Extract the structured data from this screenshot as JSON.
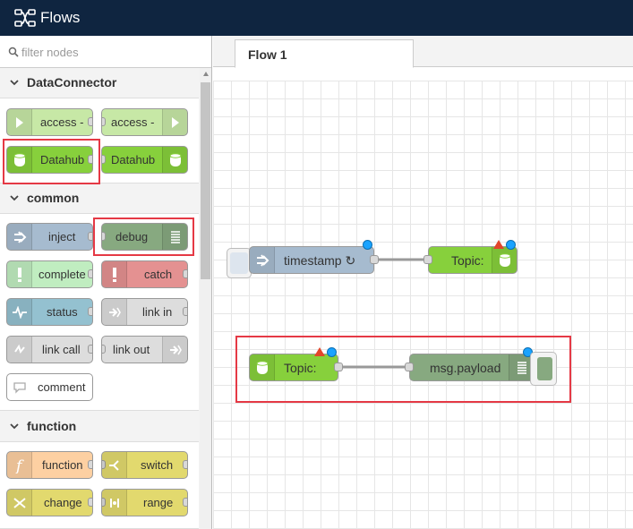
{
  "header": {
    "title": "Flows"
  },
  "palette": {
    "filter_placeholder": "filter nodes",
    "categories": [
      {
        "label": "DataConnector"
      },
      {
        "label": "common"
      },
      {
        "label": "function"
      }
    ],
    "nodes": {
      "access_sub": "access -",
      "access_pub": "access -",
      "datahub_sub": "Datahub",
      "datahub_pub": "Datahub",
      "inject": "inject",
      "debug": "debug",
      "complete": "complete",
      "catch": "catch",
      "status": "status",
      "link_in": "link in",
      "link_call": "link call",
      "link_out": "link out",
      "comment": "comment",
      "function": "function",
      "switch": "switch",
      "change": "change",
      "range": "range"
    }
  },
  "workspace": {
    "tabs": [
      {
        "label": "Flow 1"
      }
    ],
    "nodes": {
      "timestamp": "timestamp ↻",
      "topic_out": "Topic:",
      "topic_in": "Topic:",
      "msg_payload": "msg.payload"
    }
  },
  "colors": {
    "header_bg": "#0f2540",
    "dataconnector_green": "#87d03c",
    "dataconnector_green_light": "#c7e8a6",
    "inject_blue": "#a6bbcf",
    "debug_green": "#87a980",
    "catch_red": "#e49191",
    "status_blue": "#94c1d0",
    "link_grey": "#dddddd",
    "function_orange": "#fdd0a2",
    "switch_yellow": "#e2d96e",
    "complete_green": "#c0edc0",
    "highlight_red": "#e53945",
    "status_dot_blue": "#1aa3ff",
    "warning_red": "#e2462b"
  }
}
